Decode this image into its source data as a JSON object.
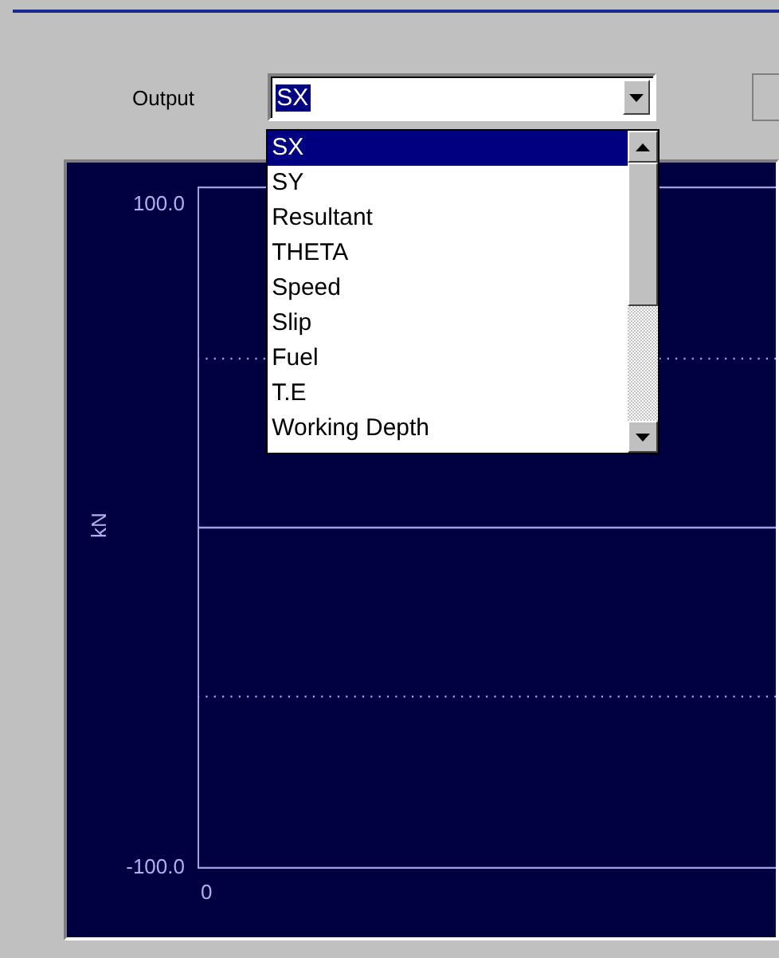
{
  "output": {
    "label": "Output",
    "value": "SX",
    "expanded": true,
    "options": [
      {
        "label": "SX",
        "selected": true
      },
      {
        "label": "SY",
        "selected": false
      },
      {
        "label": "Resultant",
        "selected": false
      },
      {
        "label": "THETA",
        "selected": false
      },
      {
        "label": "Speed",
        "selected": false
      },
      {
        "label": "Slip",
        "selected": false
      },
      {
        "label": "Fuel",
        "selected": false
      },
      {
        "label": "T.E",
        "selected": false
      },
      {
        "label": "Working Depth",
        "selected": false
      }
    ]
  },
  "chart": {
    "ylabel": "kN",
    "y_top_label": "100.0",
    "y_bottom_label": "-100.0",
    "x_start_label": "0"
  }
}
